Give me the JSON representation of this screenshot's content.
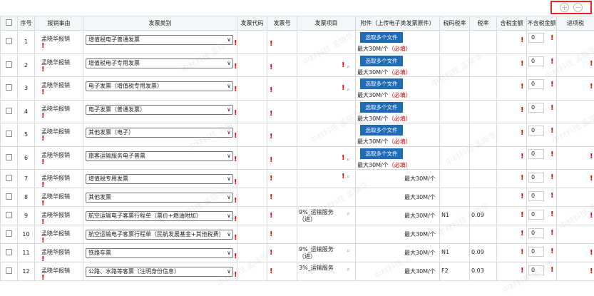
{
  "toolbar": {
    "add_icon": "+",
    "remove_icon": "−"
  },
  "columns": [
    "",
    "序号",
    "报销事由",
    "发票类别",
    "发票代码",
    "发票号",
    "发票项目",
    "附件（上传电子类发票原件）",
    "税码税率",
    "税率",
    "含税金额",
    "不含税金额",
    "进项税"
  ],
  "upload_label": "选取多个文件",
  "limit_text": "最大30M/个",
  "required_text": "（必填）",
  "rows": [
    {
      "no": "1",
      "reason": "孟晓华报销",
      "type": "增值税电子普通发票",
      "project": "",
      "upload": true,
      "tax_code": "",
      "rate": "",
      "amount_ex": "0"
    },
    {
      "no": "2",
      "reason": "孟晓华报销",
      "type": "增值税电子专用发票",
      "project": "",
      "upload": true,
      "tax_code": "",
      "rate": "",
      "amount_ex": "0"
    },
    {
      "no": "3",
      "reason": "孟晓华报销",
      "type": "电子发票（增值税专用发票）",
      "project": "",
      "upload": true,
      "tax_code": "",
      "rate": "",
      "amount_ex": "0"
    },
    {
      "no": "4",
      "reason": "孟晓华报销",
      "type": "电子发票（普通发票）",
      "project": "",
      "upload": true,
      "tax_code": "",
      "rate": "",
      "amount_ex": "0"
    },
    {
      "no": "5",
      "reason": "孟晓华报销",
      "type": "其他发票（电子）",
      "project": "",
      "upload": true,
      "tax_code": "",
      "rate": "",
      "amount_ex": "0"
    },
    {
      "no": "6",
      "reason": "孟晓华报销",
      "type": "旅客运输服务电子普票",
      "project": "",
      "upload": true,
      "tax_code": "",
      "rate": "",
      "amount_ex": "0"
    },
    {
      "no": "7",
      "reason": "孟晓华报销",
      "type": "增值税专用发票",
      "project": "",
      "upload": false,
      "tax_code": "",
      "rate": "",
      "amount_ex": "0"
    },
    {
      "no": "8",
      "reason": "孟晓华报销",
      "type": "其他发票",
      "project": "",
      "upload": false,
      "tax_code": "",
      "rate": "",
      "amount_ex": "0"
    },
    {
      "no": "9",
      "reason": "孟晓华报销",
      "type": "航空运输电子客票行程单（票价+燃油附加）",
      "project": "9%_运输服务（进）",
      "upload": false,
      "tax_code": "N1",
      "rate": "0.09",
      "amount_ex": "0"
    },
    {
      "no": "10",
      "reason": "孟晓华报销",
      "type": "航空运输电子客票行程单（民航发展基金+其他税费）",
      "project": "",
      "upload": false,
      "tax_code": "",
      "rate": "",
      "amount_ex": "0"
    },
    {
      "no": "11",
      "reason": "孟晓华报销",
      "type": "铁路车票",
      "project": "9%_运输服务（进）",
      "upload": false,
      "tax_code": "N1",
      "rate": "0.09",
      "amount_ex": "0"
    },
    {
      "no": "12",
      "reason": "孟晓华报销",
      "type": "公路、水路等客票（注明身份信息）",
      "project": "3%_运输服务",
      "upload": false,
      "tax_code": "F2",
      "rate": "0.03",
      "amount_ex": "0"
    }
  ],
  "watermark": "中材科技 孟晓华"
}
